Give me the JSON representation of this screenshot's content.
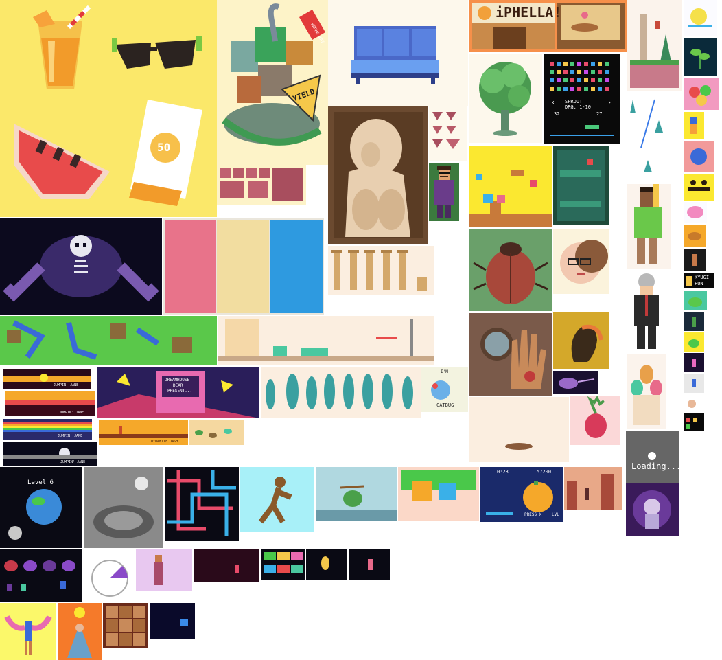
{
  "sign": {
    "text": "iPHELLA!"
  },
  "sunscreen": {
    "spf": "50"
  },
  "road_signs": {
    "yield": "YIELD",
    "wrong_way": "WRONG WAY"
  },
  "sprout_game": {
    "title": "SPROUT",
    "subtitle": "DRG. 1-10",
    "score_left": "32",
    "score_right": "27"
  },
  "jumpin_jane": {
    "caption": "JUMPIN' JANE"
  },
  "dynamite_dash": {
    "caption": "DYNAMITE DASH"
  },
  "dreamhouse": {
    "line1": "DREAMHOUSE",
    "line2": "DEAR",
    "line3": "PRESENT..."
  },
  "catbug": {
    "greeting": "I'M",
    "name": "CATBUG"
  },
  "level_screen": {
    "label": "Level 6"
  },
  "loading_screen": {
    "label": "Loading..."
  },
  "pumpkin_game": {
    "time": "0:23",
    "score": "57200",
    "prompt": "PRESS X",
    "level_tag": "LVL"
  },
  "kyugi_fun": {
    "line1": "KYUGI",
    "line2": "FUN"
  },
  "colors": {
    "swatch_pink": "#e8738a",
    "swatch_cream": "#f2dda0",
    "swatch_blue": "#2e9ae0",
    "summer_bg": "#fbe86a",
    "night_bg": "#0c0a1e"
  }
}
